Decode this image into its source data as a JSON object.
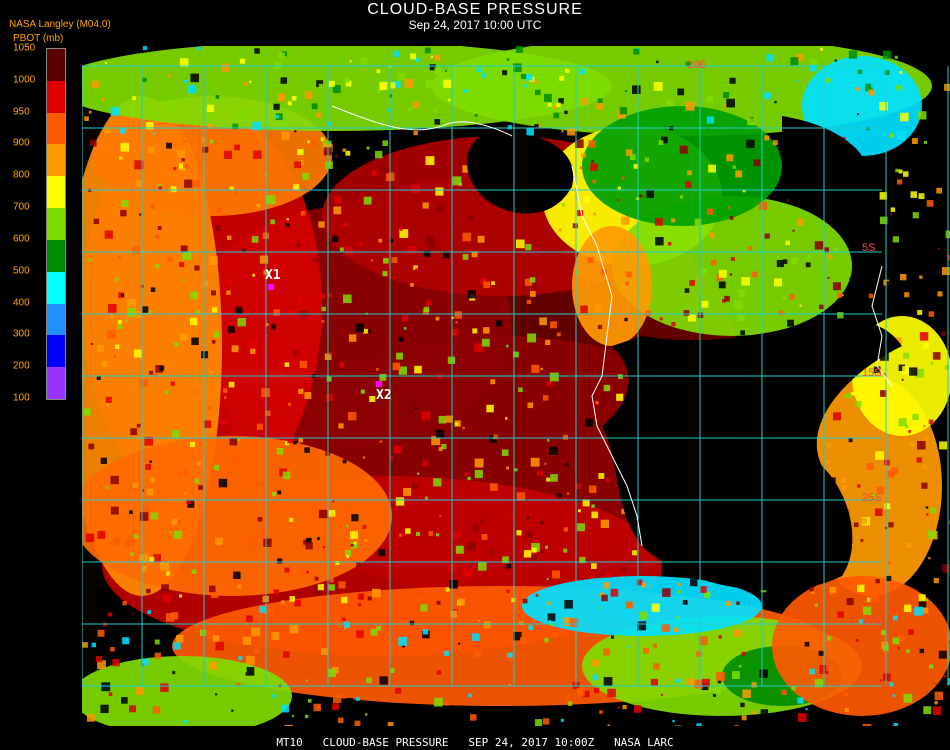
{
  "header": {
    "title": "CLOUD-BASE PRESSURE",
    "date": "Sep 24, 2017 10:00 UTC"
  },
  "producer": "NASA Langley (M04.0)",
  "legend": {
    "unit": "PBOT (mb)",
    "ticks": [
      "1050",
      "1000",
      "950",
      "900",
      "800",
      "700",
      "600",
      "500",
      "400",
      "300",
      "200",
      "100"
    ],
    "colors": [
      "#5a0000",
      "#8b0000",
      "#e00000",
      "#ff5a00",
      "#ff9a00",
      "#ffff00",
      "#7fdc00",
      "#008c00",
      "#00ffff",
      "#2090ff",
      "#0000ff",
      "#9933ff"
    ]
  },
  "markers": [
    {
      "label": "X1"
    },
    {
      "label": "X2"
    }
  ],
  "grid_labels": [
    "5S",
    "15S",
    "25S",
    "35S",
    "20E"
  ],
  "footer": "MT10   CLOUD-BASE PRESSURE   SEP 24, 2017 10:00Z   NASA LARC"
}
